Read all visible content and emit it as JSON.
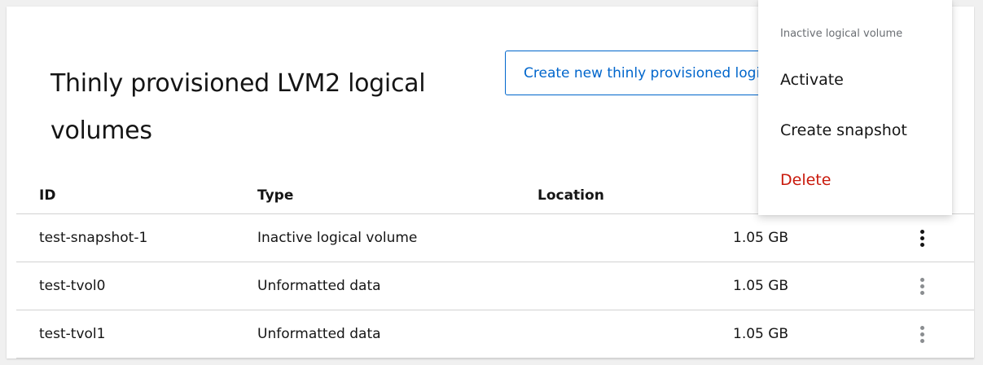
{
  "card": {
    "title": "Thinly provisioned LVM2 logical volumes",
    "create_button_label": "Create new thinly provisioned logical volume"
  },
  "table": {
    "headers": {
      "id": "ID",
      "type": "Type",
      "location": "Location"
    },
    "rows": [
      {
        "id": "test-snapshot-1",
        "type": "Inactive logical volume",
        "location": "",
        "size": "1.05 GB"
      },
      {
        "id": "test-tvol0",
        "type": "Unformatted data",
        "location": "",
        "size": "1.05 GB"
      },
      {
        "id": "test-tvol1",
        "type": "Unformatted data",
        "location": "",
        "size": "1.05 GB"
      }
    ]
  },
  "menu": {
    "group_title": "Inactive logical volume",
    "items": [
      "Activate",
      "Create snapshot",
      "Delete"
    ]
  },
  "colors": {
    "accent": "#0066cc",
    "danger": "#c9190b",
    "border": "#d2d2d2"
  },
  "icons": {
    "row_actions": "kebab-icon"
  }
}
